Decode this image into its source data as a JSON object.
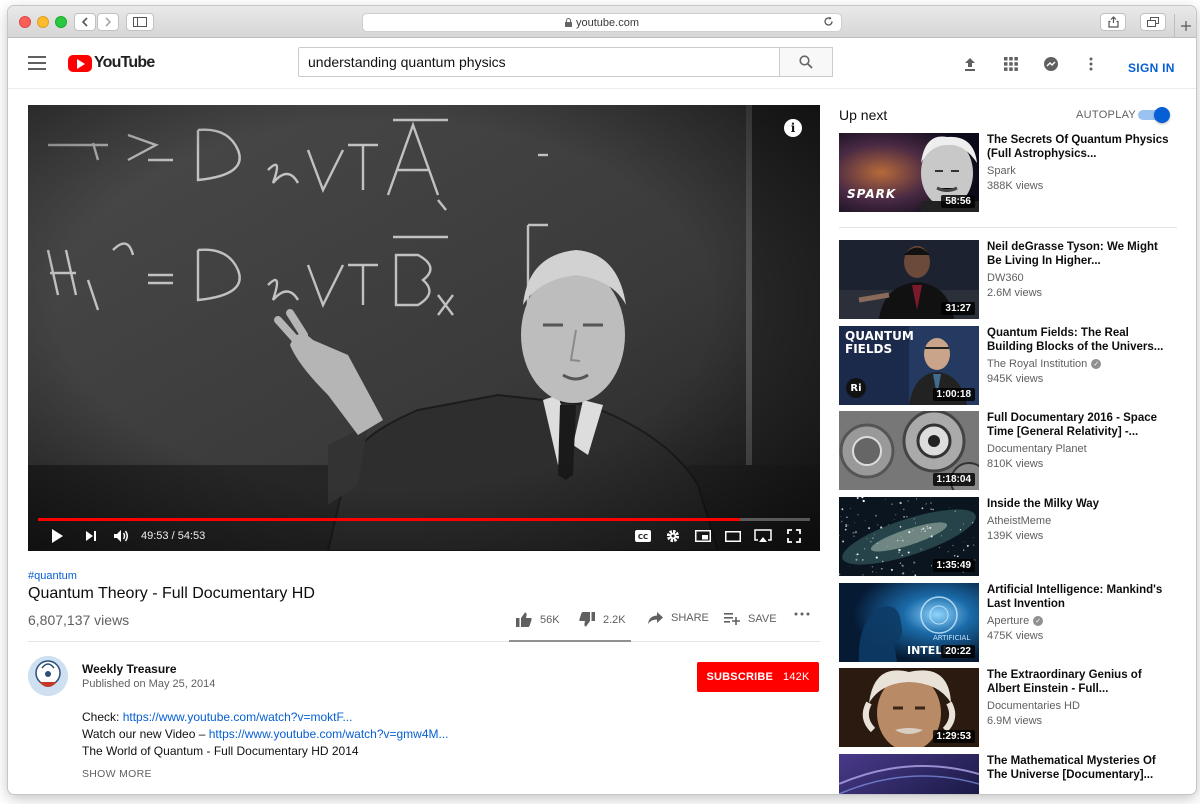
{
  "browser": {
    "url": "youtube.com"
  },
  "header": {
    "logo_text": "YouTube",
    "search_query": "understanding quantum physics",
    "sign_in": "SIGN IN",
    "icons": [
      "menu-icon",
      "upload-icon",
      "apps-icon",
      "messages-icon",
      "more-icon"
    ]
  },
  "player": {
    "time": "49:53 / 54:53",
    "progress": 0.909
  },
  "video": {
    "hashtag": "#quantum",
    "title": "Quantum Theory - Full Documentary HD",
    "views": "6,807,137 views",
    "likes": "56K",
    "dislikes": "2.2K",
    "share": "SHARE",
    "save": "SAVE"
  },
  "channel": {
    "name": "Weekly Treasure",
    "published": "Published on May 25, 2014",
    "subscribe_label": "SUBSCRIBE",
    "subscriber_count": "142K"
  },
  "description": {
    "line1_prefix": "Check: ",
    "line1_link": "https://www.youtube.com/watch?v=moktF...",
    "line2_prefix": "Watch our new Video – ",
    "line2_link": "https://www.youtube.com/watch?v=gmw4M...",
    "line3": "The World of Quantum - Full Documentary  HD 2014",
    "show_more": "SHOW MORE"
  },
  "sidebar": {
    "up_next": "Up next",
    "autoplay": "AUTOPLAY",
    "autoplay_on": true,
    "videos": [
      {
        "title": "The Secrets Of Quantum Physics (Full Astrophysics...",
        "channel": "Spark",
        "views": "388K views",
        "duration": "58:56",
        "verified": false,
        "thumb_text": "SPARK"
      },
      {
        "title": "Neil deGrasse Tyson: We Might Be Living In Higher...",
        "channel": "DW360",
        "views": "2.6M views",
        "duration": "31:27",
        "verified": false
      },
      {
        "title": "Quantum Fields: The Real Building Blocks of the Univers...",
        "channel": "The Royal Institution",
        "views": "945K views",
        "duration": "1:00:18",
        "verified": true,
        "thumb_text": "QUANTUM FIELDS",
        "thumb_badge": "Ri"
      },
      {
        "title": "Full Documentary 2016 - Space Time [General Relativity] -...",
        "channel": "Documentary Planet",
        "views": "810K views",
        "duration": "1:18:04",
        "verified": false
      },
      {
        "title": "Inside the Milky Way",
        "channel": "AtheistMeme",
        "views": "139K views",
        "duration": "1:35:49",
        "verified": false
      },
      {
        "title": "Artificial Intelligence: Mankind's Last Invention",
        "channel": "Aperture",
        "views": "475K views",
        "duration": "20:22",
        "verified": true,
        "thumb_text": "INTELL",
        "thumb_text2": "ARTIFICIAL"
      },
      {
        "title": "The Extraordinary Genius of Albert Einstein - Full...",
        "channel": "Documentaries HD",
        "views": "6.9M views",
        "duration": "1:29:53",
        "verified": false
      },
      {
        "title": "The Mathematical Mysteries Of The Universe [Documentary]...",
        "channel": "",
        "views": "",
        "duration": "",
        "verified": false
      }
    ]
  }
}
